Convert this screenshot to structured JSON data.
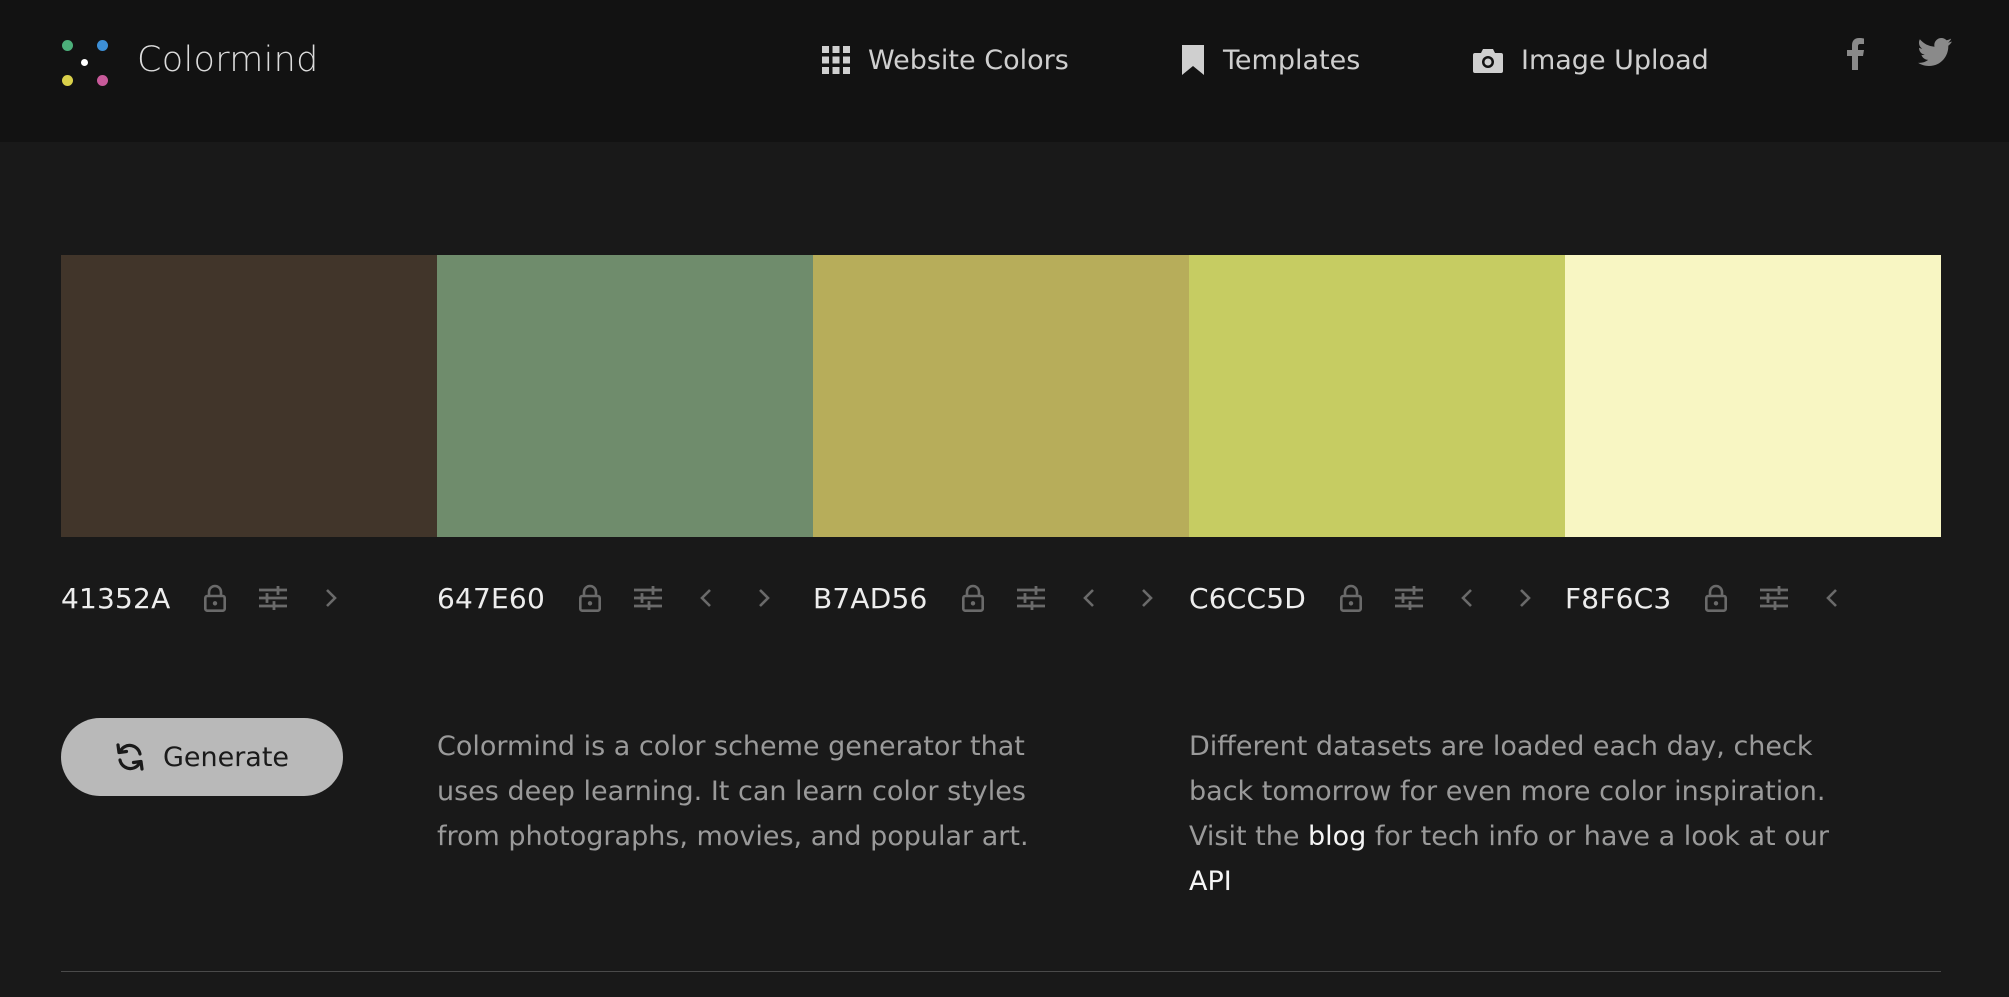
{
  "header": {
    "brand": "Colormind",
    "nav": [
      {
        "label": "Website Colors",
        "icon": "grid-icon"
      },
      {
        "label": "Templates",
        "icon": "bookmark-icon"
      },
      {
        "label": "Image Upload",
        "icon": "camera-icon"
      }
    ],
    "social": [
      "facebook-icon",
      "twitter-icon"
    ]
  },
  "palette": [
    {
      "hex": "41352A",
      "color": "#41352A"
    },
    {
      "hex": "647E60",
      "color": "#6F8C6C"
    },
    {
      "hex": "B7AD56",
      "color": "#B7AD5A"
    },
    {
      "hex": "C6CC5D",
      "color": "#C6CC62"
    },
    {
      "hex": "F8F6C3",
      "color": "#F8F6C3"
    }
  ],
  "generate": {
    "label": "Generate"
  },
  "description_left": "Colormind is a color scheme generator that uses deep learning. It can learn color styles from photographs, movies, and popular art.",
  "description_right": {
    "before": "Different datasets are loaded each day, check back tomorrow for even more color inspiration. Visit the ",
    "blog_link": "blog",
    "middle": " for tech info or have a look at our ",
    "api_link": "API"
  }
}
